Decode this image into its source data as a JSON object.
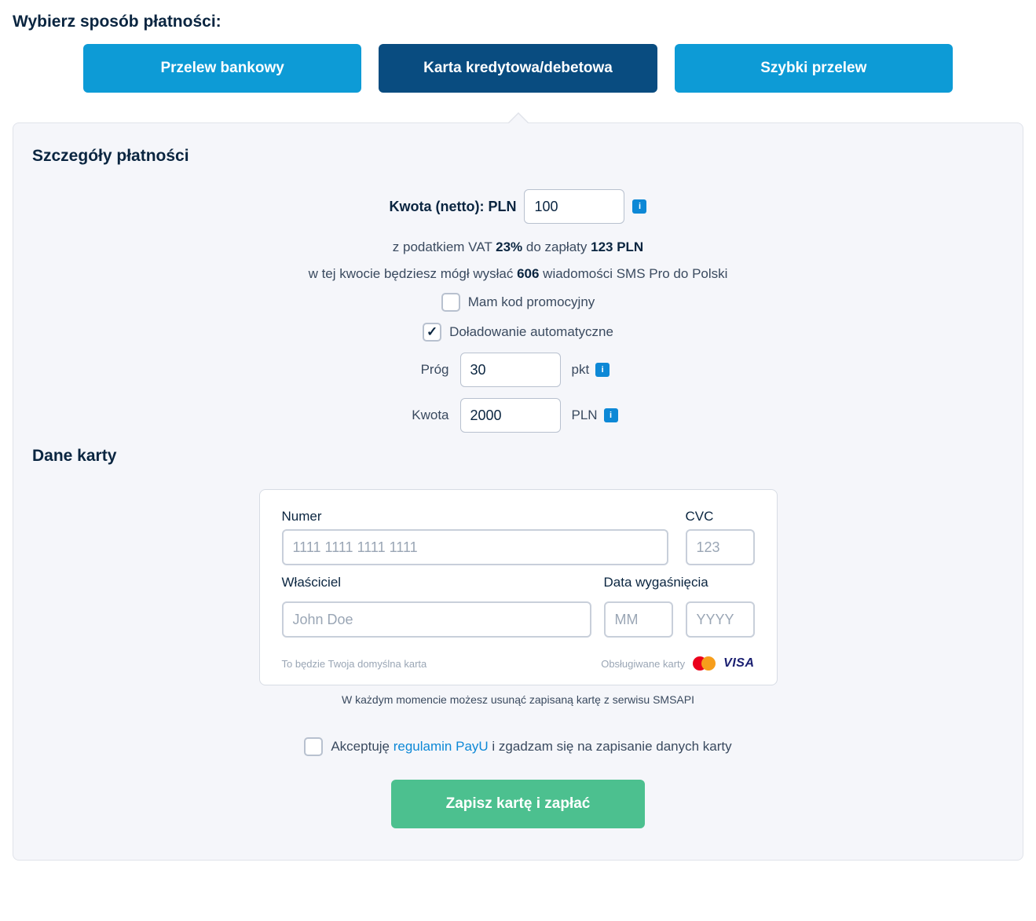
{
  "page_title": "Wybierz sposób płatności:",
  "tabs": {
    "bank_transfer": "Przelew bankowy",
    "card": "Karta kredytowa/debetowa",
    "fast_transfer": "Szybki przelew"
  },
  "details": {
    "title": "Szczegóły płatności",
    "amount_label": "Kwota (netto): PLN",
    "amount_value": "100",
    "vat_prefix": "z podatkiem VAT ",
    "vat_rate": "23%",
    "vat_mid": " do zapłaty ",
    "vat_total": "123 PLN",
    "sms_prefix": "w tej kwocie będziesz mógł wysłać ",
    "sms_count": "606",
    "sms_suffix": " wiadomości SMS Pro do Polski",
    "promo_label": "Mam kod promocyjny",
    "auto_label": "Doładowanie automatyczne",
    "threshold_label": "Próg",
    "threshold_value": "30",
    "threshold_unit": "pkt",
    "amount2_label": "Kwota",
    "amount2_value": "2000",
    "amount2_unit": "PLN"
  },
  "card": {
    "title": "Dane karty",
    "number_label": "Numer",
    "number_ph": "1111 1111 1111 1111",
    "cvc_label": "CVC",
    "cvc_ph": "123",
    "owner_label": "Właściciel",
    "owner_ph": "John Doe",
    "exp_label": "Data wygaśnięcia",
    "mm_ph": "MM",
    "yyyy_ph": "YYYY",
    "default_note": "To będzie Twoja domyślna karta",
    "supported_note": "Obsługiwane karty",
    "visa": "VISA"
  },
  "info_note": "W każdym momencie możesz usunąć zapisaną kartę z serwisu SMSAPI",
  "accept": {
    "pre": "Akceptuję ",
    "link": "regulamin PayU",
    "post": " i zgadzam się na zapisanie danych karty"
  },
  "submit": "Zapisz kartę i zapłać",
  "info_glyph": "i"
}
